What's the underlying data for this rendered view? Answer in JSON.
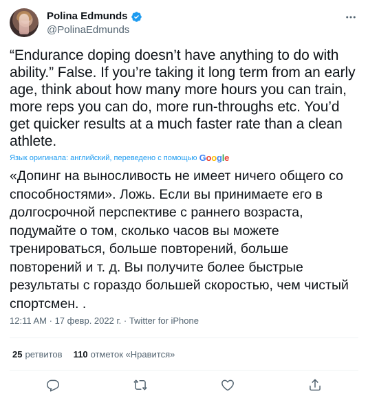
{
  "author": {
    "display_name": "Polina Edmunds",
    "handle": "@PolinaEdmunds",
    "verified": true
  },
  "tweet": {
    "text": "“Endurance doping doesn’t have anything to do with ability.” False. If you’re taking it long term from an early age, think about how many more hours you can train, more reps you can do, more run-throughs etc. You’d get quicker results at a much faster rate than a clean athlete.",
    "translation_label": "Язык оригинала: английский, переведено с помощью",
    "translation_provider": "Google",
    "translated_text": "«Допинг на выносливость не имеет ничего общего со способностями». Ложь. Если вы принимаете его в долгосрочной перспективе с раннего возраста, подумайте о том, сколько часов вы можете тренироваться, больше повторений, больше повторений и т. д. Вы получите более быстрые результаты с гораздо большей скоростью, чем чистый спортсмен. .",
    "time": "12:11 AM",
    "separator": "·",
    "date": "17 февр. 2022 г.",
    "source": "Twitter for iPhone"
  },
  "stats": {
    "retweets_count": "25",
    "retweets_label": "ретвитов",
    "likes_count": "110",
    "likes_label": "отметок «Нравится»"
  },
  "icons": {
    "verified": "verified-badge-icon",
    "more": "more-options-icon",
    "reply": "reply-icon",
    "retweet": "retweet-icon",
    "like": "like-icon",
    "share": "share-icon"
  },
  "colors": {
    "accent": "#1d9bf0",
    "text": "#0f1419",
    "secondary": "#536471",
    "divider": "#eff3f4"
  }
}
